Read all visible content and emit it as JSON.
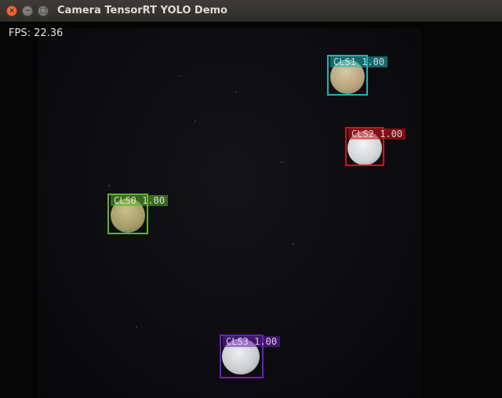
{
  "window": {
    "title": "Camera TensorRT YOLO Demo",
    "close_glyph": "×",
    "minimize_glyph": "−",
    "maximize_glyph": "□"
  },
  "overlay": {
    "fps_text": "FPS: 22.36"
  },
  "detections": [
    {
      "class_label": "CLS0",
      "score": "1.00",
      "color": "#5db32a"
    },
    {
      "class_label": "CLS1",
      "score": "1.00",
      "color": "#1fb5b8"
    },
    {
      "class_label": "CLS2",
      "score": "1.00",
      "color": "#c8161d"
    },
    {
      "class_label": "CLS3",
      "score": "1.00",
      "color": "#6c1fb5"
    }
  ]
}
